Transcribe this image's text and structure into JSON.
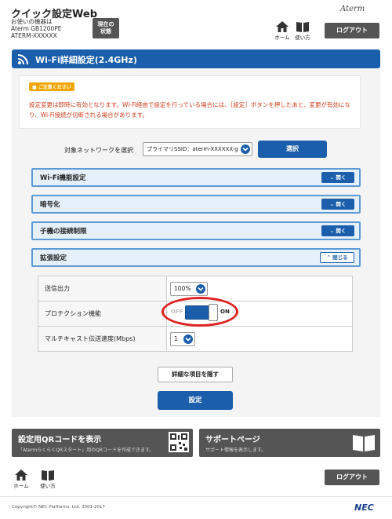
{
  "header": {
    "app_title": "クイック設定Web",
    "device_lines": [
      "お使いの機器は",
      "Aterm GB1200PE",
      "ATERM-XXXXXX"
    ],
    "status_button_lines": [
      "現在の",
      "状態"
    ],
    "brand": "Aterm",
    "home_label": "ホーム",
    "manual_label": "使い方",
    "logout_label": "ログアウト"
  },
  "page": {
    "title": "Wi-Fi詳細設定(2.4GHz)"
  },
  "caution": {
    "badge": "ご注意ください",
    "text": "設定変更は即時に有効となります。Wi-Fi経由で設定を行っている場合には、［設定］ボタンを押したあと、変更が有効になり、Wi-Fi接続が切断される場合があります。"
  },
  "network_select": {
    "label": "対象ネットワークを選択",
    "value": "プライマリSSID：aterm-XXXXXX-g",
    "button": "選択"
  },
  "sections": [
    {
      "label": "Wi-Fi機能設定",
      "button": "開く"
    },
    {
      "label": "暗号化",
      "button": "開く"
    },
    {
      "label": "子機の接続制限",
      "button": "開く"
    },
    {
      "label": "拡張設定",
      "button": "閉じる"
    }
  ],
  "extended_settings": {
    "tx_power_label": "送信出力",
    "tx_power_value": "100%",
    "protection_label": "プロテクション機能",
    "protection_off": "OFF",
    "protection_on": "ON",
    "protection_state": "ON",
    "multicast_label": "マルチキャスト伝送速度(Mbps)",
    "multicast_value": "1"
  },
  "actions": {
    "hide_details": "詳細な項目を隠す",
    "apply": "設定"
  },
  "cards": {
    "qr_title": "設定用QRコードを表示",
    "qr_desc": "「AtermらくらくQRスタート」用のQRコードを作成できます。",
    "support_title": "サポートページ",
    "support_desc": "サポート情報を表示します。"
  },
  "footer": {
    "home_label": "ホーム",
    "manual_label": "使い方",
    "logout_label": "ログアウト",
    "copyright": "Copyright© NEC Platforms, Ltd. 2001-2017",
    "logo": "NEC"
  },
  "colors": {
    "primary_blue": "#1b5eab",
    "section_border": "#5c9ad6",
    "caution_red": "#d23c1e",
    "highlight_ring": "#e02020",
    "dark_button": "#555555"
  }
}
